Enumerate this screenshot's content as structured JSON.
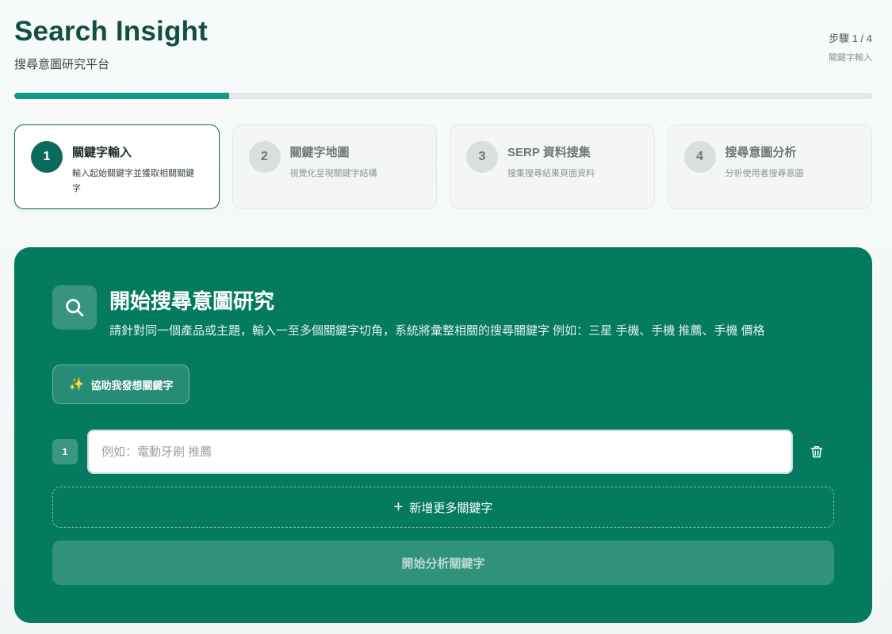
{
  "header": {
    "title": "Search Insight",
    "subtitle": "搜尋意圖研究平台",
    "step_count": "步驟 1 / 4",
    "step_name": "關鍵字輸入"
  },
  "progress": {
    "value_percent": 25,
    "color": "#0f9a8c"
  },
  "steps": [
    {
      "number": "1",
      "title": "關鍵字輸入",
      "desc": "輸入起始關鍵字並獲取相關關鍵字",
      "active": true
    },
    {
      "number": "2",
      "title": "關鍵字地圖",
      "desc": "視覺化呈現關鍵字結構",
      "active": false
    },
    {
      "number": "3",
      "title": "SERP 資料搜集",
      "desc": "搜集搜尋結果頁面資料",
      "active": false
    },
    {
      "number": "4",
      "title": "搜尋意圖分析",
      "desc": "分析使用者搜尋意圖",
      "active": false
    }
  ],
  "panel": {
    "icon": "search-icon",
    "title": "開始搜尋意圖研究",
    "desc": "請針對同一個產品或主題，輸入一至多個關鍵字切角，系統將彙整相關的搜尋關鍵字 例如：三星 手機、手機 推薦、手機 價格",
    "brainstorm_label": "協助我發想關鍵字",
    "brainstorm_icon": "sparkles-icon",
    "keywords": [
      {
        "index": "1",
        "value": "",
        "placeholder": "例如：電動牙刷 推薦"
      }
    ],
    "delete_icon": "trash-icon",
    "add_more_label": "新增更多關鍵字",
    "add_icon": "plus-icon",
    "analyze_label": "開始分析關鍵字",
    "color": "#047a5f"
  }
}
